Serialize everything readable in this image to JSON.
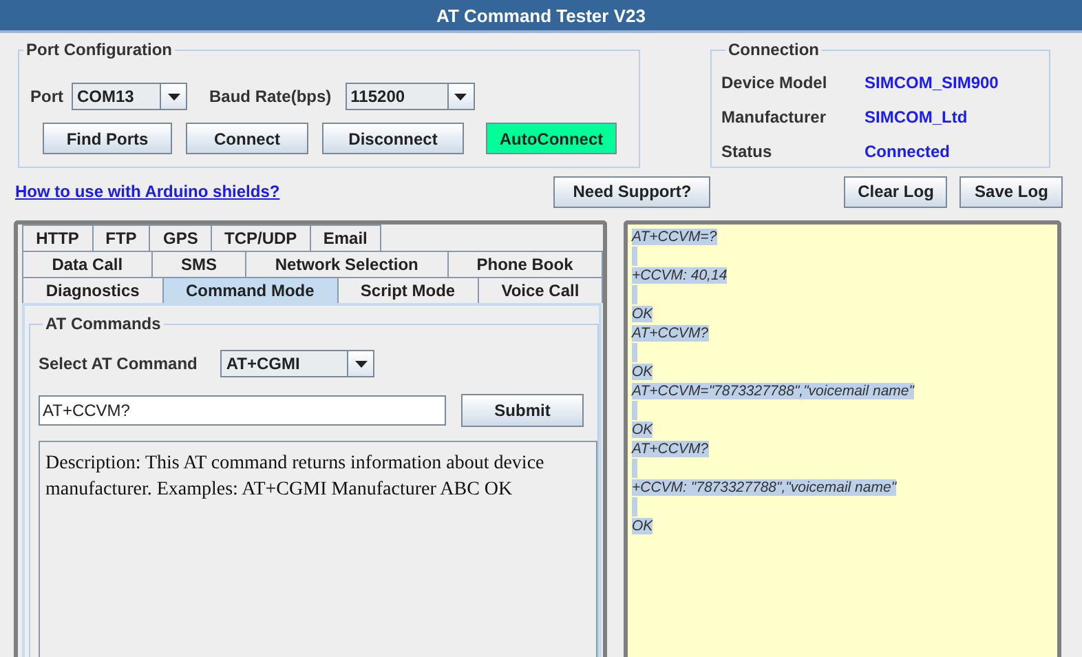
{
  "window": {
    "title": "AT Command Tester V23"
  },
  "port_configuration": {
    "title": "Port Configuration",
    "port_label": "Port",
    "port_value": "COM13",
    "baud_label": "Baud Rate(bps)",
    "baud_value": "115200",
    "buttons": [
      {
        "label": "Find Ports",
        "kind": "plain"
      },
      {
        "label": "Connect",
        "kind": "plain"
      },
      {
        "label": "Disconnect",
        "kind": "plain"
      },
      {
        "label": "AutoConnect",
        "kind": "highlight"
      }
    ]
  },
  "connection": {
    "title": "Connection",
    "rows": [
      {
        "label": "Device Model",
        "value": "SIMCOM_SIM900"
      },
      {
        "label": "Manufacturer",
        "value": "SIMCOM_Ltd"
      },
      {
        "label": "Status",
        "value": "Connected"
      }
    ]
  },
  "help_link": "How to use with Arduino shields?",
  "support_button": "Need Support?",
  "log_buttons": [
    "Clear Log",
    "Save Log"
  ],
  "tab_rows": [
    [
      {
        "label": "HTTP",
        "selected": false
      },
      {
        "label": "FTP",
        "selected": false
      },
      {
        "label": "GPS",
        "selected": false
      },
      {
        "label": "TCP/UDP",
        "selected": false
      },
      {
        "label": "Email",
        "selected": false
      }
    ],
    [
      {
        "label": "Data Call",
        "selected": false
      },
      {
        "label": "SMS",
        "selected": false
      },
      {
        "label": "Network Selection",
        "selected": false
      },
      {
        "label": "Phone Book",
        "selected": false
      }
    ],
    [
      {
        "label": "Diagnostics",
        "selected": false
      },
      {
        "label": "Command Mode",
        "selected": true
      },
      {
        "label": "Script Mode",
        "selected": false
      },
      {
        "label": "Voice Call",
        "selected": false
      }
    ]
  ],
  "at_commands": {
    "title": "AT Commands",
    "select_label": "Select AT Command",
    "select_value": "AT+CGMI",
    "command_value": "AT+CCVM?",
    "submit": "Submit",
    "description": "Description: This AT command returns information about device manufacturer. Examples: AT+CGMI Manufacturer ABC OK"
  },
  "log": [
    {
      "text": "AT+CCVM=?",
      "gap_before": false
    },
    {
      "text": "+CCVM: 40,14",
      "gap_before": true
    },
    {
      "text": "OK",
      "gap_before": true
    },
    {
      "text": "AT+CCVM?",
      "gap_before": false
    },
    {
      "text": "OK",
      "gap_before": true
    },
    {
      "text": "AT+CCVM=\"7873327788\",\"voicemail name\"",
      "gap_before": false
    },
    {
      "text": "OK",
      "gap_before": true
    },
    {
      "text": "AT+CCVM?",
      "gap_before": false
    },
    {
      "text": "+CCVM: \"7873327788\",\"voicemail name\"",
      "gap_before": true
    },
    {
      "text": "OK",
      "gap_before": true
    }
  ]
}
